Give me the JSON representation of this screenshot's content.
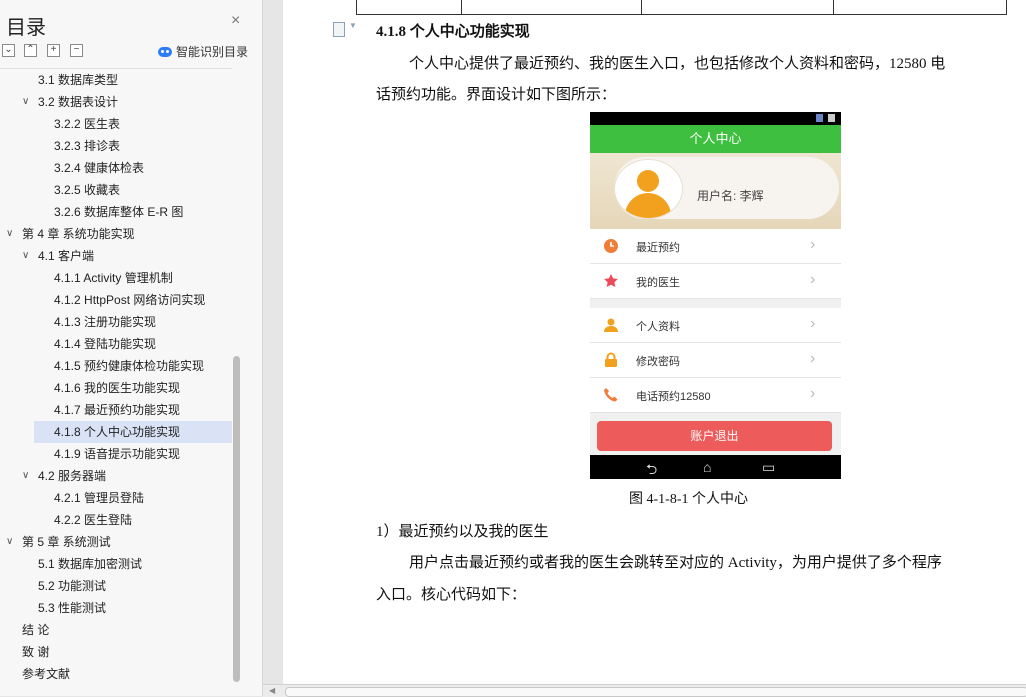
{
  "sidebar": {
    "title": "目录",
    "close_icon": "close-icon",
    "tools": [
      "collapse-all-icon",
      "expand-icon",
      "add-icon",
      "remove-icon"
    ],
    "ai_toc_label": "智能识别目录",
    "items": [
      {
        "label": "3.1  数据库类型",
        "level": 1,
        "arrow": ""
      },
      {
        "label": "3.2  数据表设计",
        "level": 1,
        "arrow": "v"
      },
      {
        "label": "3.2.2  医生表",
        "level": 2,
        "arrow": ""
      },
      {
        "label": "3.2.3  排诊表",
        "level": 2,
        "arrow": ""
      },
      {
        "label": "3.2.4  健康体检表",
        "level": 2,
        "arrow": ""
      },
      {
        "label": "3.2.5  收藏表",
        "level": 2,
        "arrow": ""
      },
      {
        "label": "3.2.6  数据库整体 E-R 图",
        "level": 2,
        "arrow": ""
      },
      {
        "label": "第 4 章  系统功能实现",
        "level": 0,
        "arrow": "v"
      },
      {
        "label": "4.1  客户端",
        "level": 1,
        "arrow": "v"
      },
      {
        "label": "4.1.1 Activity 管理机制",
        "level": 2,
        "arrow": ""
      },
      {
        "label": "4.1.2 HttpPost 网络访问实现",
        "level": 2,
        "arrow": ""
      },
      {
        "label": "4.1.3  注册功能实现",
        "level": 2,
        "arrow": ""
      },
      {
        "label": "4.1.4  登陆功能实现",
        "level": 2,
        "arrow": ""
      },
      {
        "label": "4.1.5  预约健康体检功能实现",
        "level": 2,
        "arrow": ""
      },
      {
        "label": "4.1.6  我的医生功能实现",
        "level": 2,
        "arrow": ""
      },
      {
        "label": "4.1.7  最近预约功能实现",
        "level": 2,
        "arrow": ""
      },
      {
        "label": "4.1.8  个人中心功能实现",
        "level": 2,
        "arrow": "",
        "selected": true
      },
      {
        "label": "4.1.9  语音提示功能实现",
        "level": 2,
        "arrow": ""
      },
      {
        "label": "4.2  服务器端",
        "level": 1,
        "arrow": "v"
      },
      {
        "label": "4.2.1  管理员登陆",
        "level": 2,
        "arrow": ""
      },
      {
        "label": "4.2.2  医生登陆",
        "level": 2,
        "arrow": ""
      },
      {
        "label": "第 5 章  系统测试",
        "level": 0,
        "arrow": "v"
      },
      {
        "label": "5.1  数据库加密测试",
        "level": 1,
        "arrow": ""
      },
      {
        "label": "5.2  功能测试",
        "level": 1,
        "arrow": ""
      },
      {
        "label": "5.3  性能测试",
        "level": 1,
        "arrow": ""
      },
      {
        "label": "结    论",
        "level": 0,
        "arrow": ""
      },
      {
        "label": "致    谢",
        "level": 0,
        "arrow": ""
      },
      {
        "label": "参考文献",
        "level": 0,
        "arrow": ""
      }
    ]
  },
  "document": {
    "heading": "4.1.8  个人中心功能实现",
    "para1_line1": "个人中心提供了最近预约、我的医生入口，也包括修改个人资料和密码，12580 电",
    "para1_line2": "话预约功能。界面设计如下图所示：",
    "caption": "图 4-1-8-1    个人中心",
    "subheading": "1）最近预约以及我的医生",
    "para2_line1": "用户点击最近预约或者我的医生会跳转至对应的  Activity，为用户提供了多个程序",
    "para2_line2": "入口。核心代码如下："
  },
  "phone": {
    "title": "个人中心",
    "username": "用户名:  李辉",
    "menu": [
      {
        "label": "最近预约",
        "icon": "clock-icon",
        "color": "#f07d3a"
      },
      {
        "label": "我的医生",
        "icon": "star-icon",
        "color": "#ee4b5a"
      },
      {
        "label": "个人资料",
        "icon": "person-icon",
        "color": "#f2a11e"
      },
      {
        "label": "修改密码",
        "icon": "lock-icon",
        "color": "#f2a11e"
      },
      {
        "label": "电话预约12580",
        "icon": "phone-icon",
        "color": "#f07d3a"
      }
    ],
    "logout": "账户退出",
    "accent_green": "#3fbf3f",
    "logout_red": "#ee5b5b"
  }
}
